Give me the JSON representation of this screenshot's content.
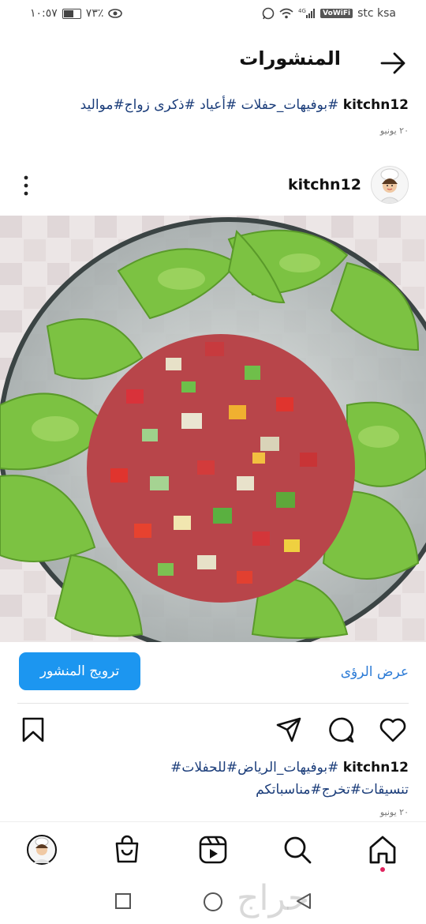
{
  "status_bar": {
    "time": "١٠:٥٧",
    "battery": "٧٣٪",
    "carrier": "stc ksa",
    "volte": "VoWiFi",
    "network": "4G"
  },
  "header": {
    "title": "المنشورات"
  },
  "top_post": {
    "username": "kitchn12",
    "caption": "#بوفيهات_حفلات #أعياد #ذكرى زواج#مواليد",
    "date": "٢٠ يونيو"
  },
  "post": {
    "username": "kitchn12",
    "promote_label": "ترويج المنشور",
    "insights_label": "عرض الرؤى",
    "caption_line1": "#بوفيهات_الرياض#للحفلات#",
    "caption_line2": "تنسيقات#تخرج#مناسباتكم",
    "date": "٢٠ يونيو"
  },
  "icons": {
    "back": "arrow-right-icon",
    "more": "more-vertical-icon",
    "like": "heart-icon",
    "comment": "comment-icon",
    "share": "send-icon",
    "save": "bookmark-icon",
    "nav": [
      "home-icon",
      "search-icon",
      "reels-icon",
      "shop-icon",
      "profile-avatar"
    ]
  },
  "watermark": "حراج",
  "colors": {
    "accent": "#1c96f0",
    "hashtag": "#1b3d7a",
    "link": "#2c7bd6",
    "notif_dot": "#e0245e"
  }
}
